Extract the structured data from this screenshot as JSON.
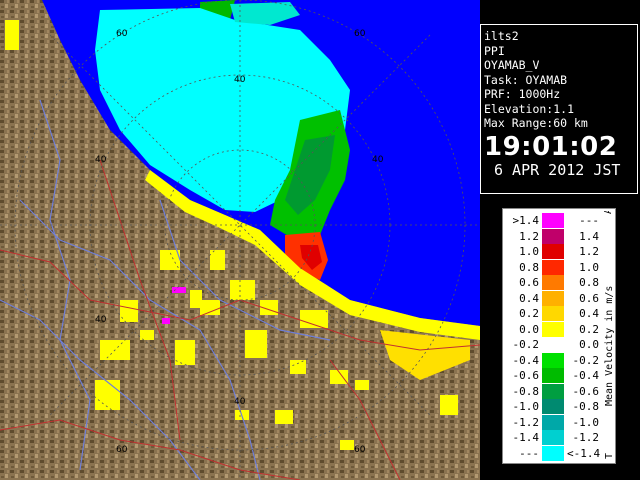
{
  "map": {
    "ring_labels": {
      "inner_top": "40",
      "outer_top": "60",
      "outer_topright": "60",
      "inner_right": "40",
      "inner_left": "40",
      "inner_left_lower": "40",
      "inner_bottom": "40",
      "outer_bottomleft": "60",
      "outer_bottomright": "60"
    }
  },
  "info": {
    "lines": [
      "ilts2",
      "PPI",
      "OYAMAB_V",
      "Task: OYAMAB",
      "PRF: 1000Hz",
      "Elevation:1.1",
      "Max Range:60 km"
    ],
    "time": "19:01:02",
    "date": "6 APR 2012 JST"
  },
  "legend": {
    "title": "Mean Velocity in m/s",
    "top_mark": "A",
    "bottom_mark": "T",
    "rows": [
      {
        "left": ">1.4",
        "color": "#ff00ff",
        "right": "---"
      },
      {
        "left": "1.2",
        "color": "#c0006a",
        "right": "1.4"
      },
      {
        "left": "1.0",
        "color": "#e00000",
        "right": "1.2"
      },
      {
        "left": "0.8",
        "color": "#ff2800",
        "right": "1.0"
      },
      {
        "left": "0.6",
        "color": "#ff7a00",
        "right": "0.8"
      },
      {
        "left": "0.4",
        "color": "#ffb000",
        "right": "0.6"
      },
      {
        "left": "0.2",
        "color": "#ffd800",
        "right": "0.4"
      },
      {
        "left": "0.0",
        "color": "#ffff00",
        "right": "0.2"
      },
      {
        "left": "-0.2",
        "color": "#ffffff",
        "right": "0.0"
      },
      {
        "left": "-0.4",
        "color": "#00e000",
        "right": "-0.2"
      },
      {
        "left": "-0.6",
        "color": "#00bb00",
        "right": "-0.4"
      },
      {
        "left": "-0.8",
        "color": "#009e40",
        "right": "-0.6"
      },
      {
        "left": "-1.0",
        "color": "#008a70",
        "right": "-0.8"
      },
      {
        "left": "-1.2",
        "color": "#00a8a8",
        "right": "-1.0"
      },
      {
        "left": "-1.4",
        "color": "#00d0d0",
        "right": "-1.2"
      },
      {
        "left": "---",
        "color": "#00ffff",
        "right": "<-1.4"
      }
    ]
  },
  "colors": {
    "sea": "#0000ff",
    "land": "#8a7350",
    "land_dark": "#5f4c2e",
    "land_light": "#b39a72",
    "echo_cyan": "#00ffff",
    "echo_green": "#00c800",
    "echo_yellow": "#ffff00",
    "echo_red": "#ff2000",
    "road": "#c23030",
    "river": "#6f7fd8",
    "grid": "#555555"
  }
}
